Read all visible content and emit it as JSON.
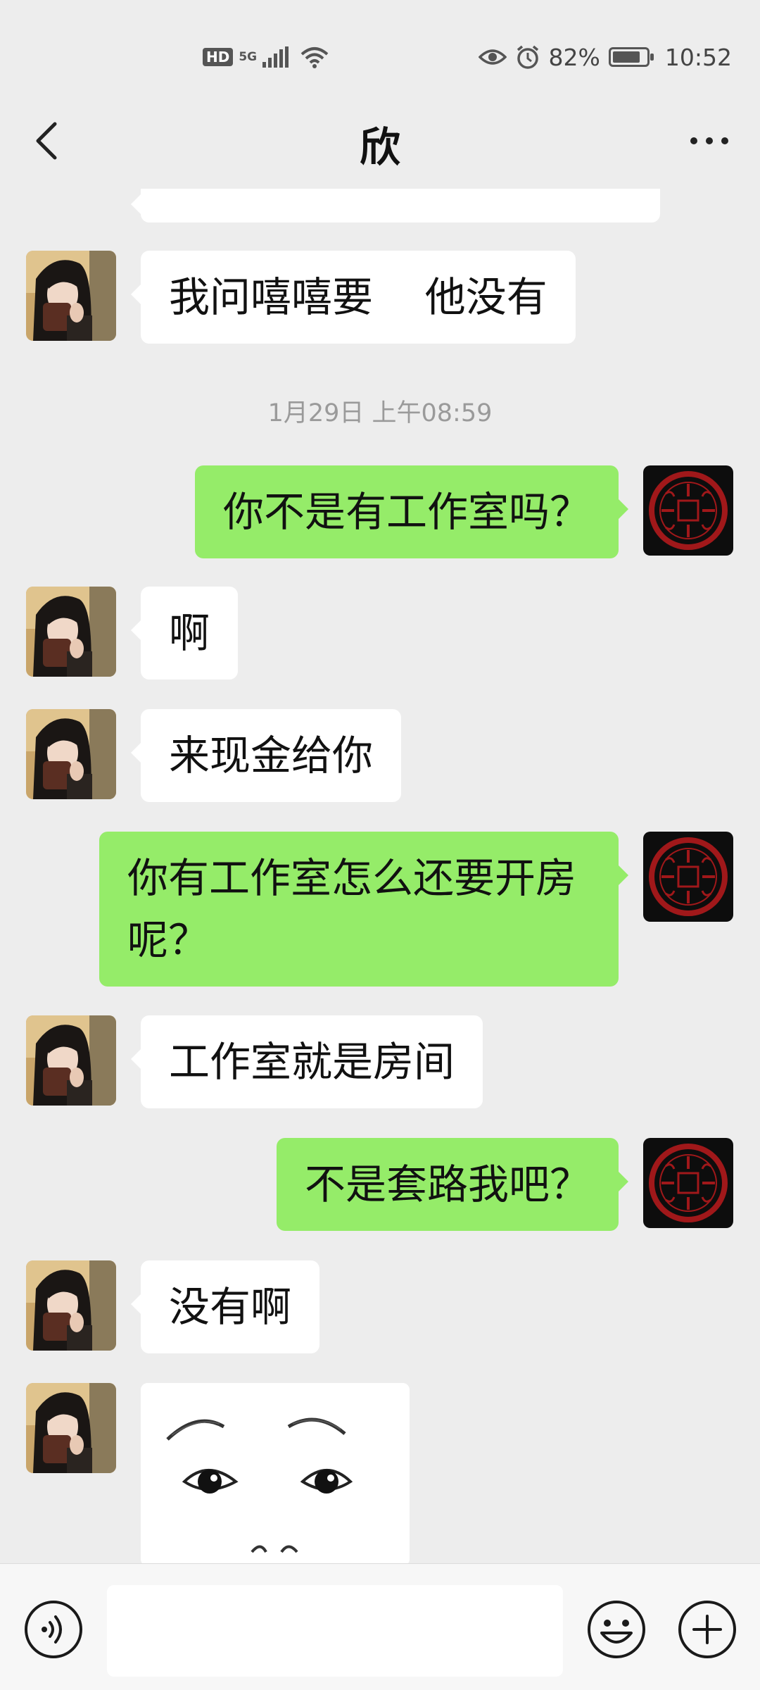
{
  "status_bar": {
    "hd_label": "HD",
    "network_label": "5G",
    "battery_percent": 82,
    "battery_text": "82%",
    "time": "10:52"
  },
  "nav": {
    "back_icon": "chevron-left-icon",
    "title": "欣",
    "more_icon": "more-icon"
  },
  "messages": [
    {
      "side": "left",
      "text": "我问嘻嘻要    他没有"
    },
    {
      "type": "timestamp",
      "text": "1月29日 上午08:59"
    },
    {
      "side": "right",
      "text": "你不是有工作室吗？"
    },
    {
      "side": "left",
      "text": "啊"
    },
    {
      "side": "left",
      "text": "来现金给你"
    },
    {
      "side": "right",
      "text": "你有工作室怎么还要开房呢？"
    },
    {
      "side": "left",
      "text": "工作室就是房间"
    },
    {
      "side": "right",
      "text": "不是套路我吧？"
    },
    {
      "side": "left",
      "text": "没有啊"
    },
    {
      "side": "left",
      "type": "image",
      "image": "wide-eyes-sticker"
    }
  ],
  "input_bar": {
    "voice_icon": "voice-icon",
    "message_placeholder": "",
    "emoji_icon": "emoji-icon",
    "plus_icon": "plus-icon"
  },
  "colors": {
    "background": "#ededed",
    "outgoing_bubble": "#95ec69",
    "incoming_bubble": "#ffffff",
    "timestamp_text": "#9a9a9a"
  }
}
